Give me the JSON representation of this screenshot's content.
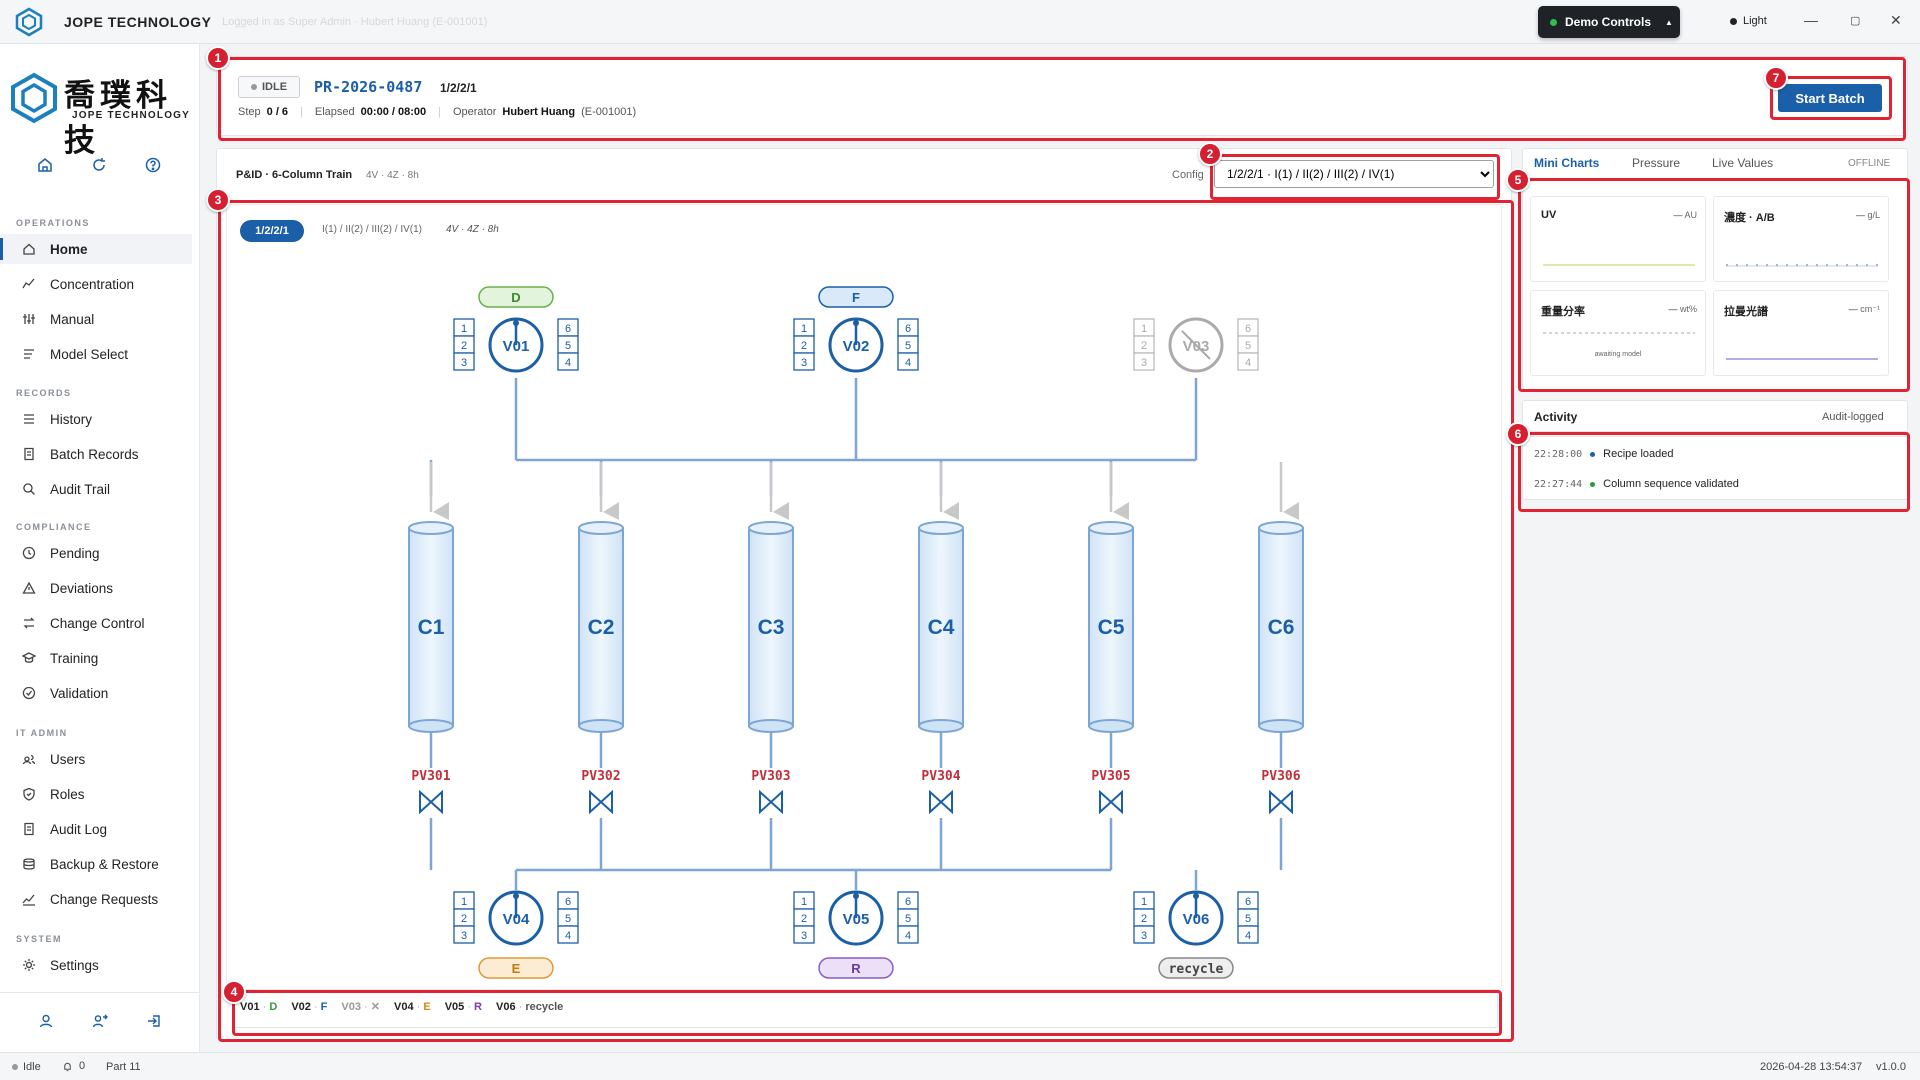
{
  "app": {
    "title": "JOPE TECHNOLOGY",
    "login": "Logged in as Super Admin · Hubert Huang (E-001001)",
    "demo_controls": "Demo Controls",
    "theme": "Light"
  },
  "brand": {
    "cn": "喬璞科技",
    "en": "JOPE TECHNOLOGY"
  },
  "sidebar": {
    "sections": [
      {
        "label": "OPERATIONS",
        "items": [
          "Home",
          "Concentration",
          "Manual",
          "Model Select"
        ]
      },
      {
        "label": "RECORDS",
        "items": [
          "History",
          "Batch Records",
          "Audit Trail"
        ]
      },
      {
        "label": "COMPLIANCE",
        "items": [
          "Pending",
          "Deviations",
          "Change Control",
          "Training",
          "Validation"
        ]
      },
      {
        "label": "IT ADMIN",
        "items": [
          "Users",
          "Roles",
          "Audit Log",
          "Backup & Restore",
          "Change Requests"
        ]
      },
      {
        "label": "SYSTEM",
        "items": [
          "Settings"
        ]
      }
    ],
    "active": "Home"
  },
  "header": {
    "status": "IDLE",
    "batch_id": "PR-2026-0487",
    "config": "1/2/2/1",
    "step_label": "Step",
    "step": "0 / 6",
    "elapsed_label": "Elapsed",
    "elapsed": "00:00 / 08:00",
    "operator_label": "Operator",
    "operator": "Hubert Huang",
    "operator_id": "(E-001001)",
    "start_button": "Start Batch"
  },
  "pid": {
    "title": "P&ID · 6-Column Train",
    "subtitle": "4V · 4Z · 8h",
    "config_label": "Config",
    "config_value": "1/2/2/1 · I(1) / II(2) / III(2) / IV(1)",
    "pill": "1/2/2/1",
    "seq": "I(1) / II(2) / III(2) / IV(1)",
    "spec": "4V · 4Z · 8h",
    "columns": [
      "C1",
      "C2",
      "C3",
      "C4",
      "C5",
      "C6"
    ],
    "valves": [
      "PV301",
      "PV302",
      "PV303",
      "PV304",
      "PV305",
      "PV306"
    ],
    "rotary_top": [
      {
        "id": "V01",
        "stream": "D"
      },
      {
        "id": "V02",
        "stream": "F"
      },
      {
        "id": "V03",
        "stream": ""
      }
    ],
    "rotary_bottom": [
      {
        "id": "V04",
        "stream": "E"
      },
      {
        "id": "V05",
        "stream": "R"
      },
      {
        "id": "V06",
        "stream": "recycle"
      }
    ],
    "port_left": [
      "1",
      "2",
      "3"
    ],
    "port_right": [
      "6",
      "5",
      "4"
    ]
  },
  "legend": [
    {
      "v": "V01",
      "s": "D",
      "c": "#3a9a3a"
    },
    {
      "v": "V02",
      "s": "F",
      "c": "#1b5fa8"
    },
    {
      "v": "V03",
      "s": "✕",
      "c": "#999"
    },
    {
      "v": "V04",
      "s": "E",
      "c": "#d0891a"
    },
    {
      "v": "V05",
      "s": "R",
      "c": "#7a3fb0"
    },
    {
      "v": "V06",
      "s": "recycle",
      "c": "#555"
    }
  ],
  "tabs": [
    "Mini Charts",
    "Pressure",
    "Live Values"
  ],
  "offline": "OFFLINE",
  "mini_charts": [
    {
      "title": "UV",
      "unit": "AU"
    },
    {
      "title": "濃度 · A/B",
      "unit": "g/L"
    },
    {
      "title": "重量分率",
      "unit": "wt%",
      "note": "awaiting model"
    },
    {
      "title": "拉曼光譜",
      "unit": "cm⁻¹"
    }
  ],
  "activity": {
    "title": "Activity",
    "audit": "Audit-logged",
    "items": [
      {
        "time": "22:28:00",
        "text": "Recipe loaded",
        "color": "#1b5fa8"
      },
      {
        "time": "22:27:44",
        "text": "Column sequence validated",
        "color": "#2a9a3a"
      }
    ]
  },
  "status": {
    "state": "Idle",
    "alerts": "0",
    "part": "Part 11",
    "datetime": "2026-04-28 13:54:37",
    "version": "v1.0.0"
  },
  "markers": [
    "1",
    "2",
    "3",
    "4",
    "5",
    "6",
    "7"
  ]
}
